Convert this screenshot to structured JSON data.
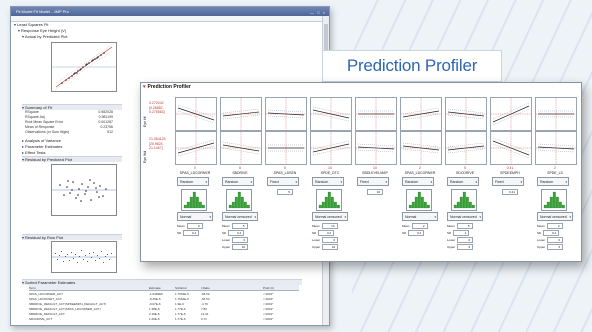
{
  "banner": {
    "title": "Prediction Profiler"
  },
  "back_window": {
    "title": "Fit Model Fit Model - JMP Pro",
    "controls": "— □ ×",
    "outline": {
      "root": "Least Squares Fit",
      "response": "Response Eye Height (V)",
      "actual_by_predicted": "Actual by Predicted Plot",
      "summary_of_fit": "Summary of Fit",
      "analysis_of_variance": "Analysis of Variance",
      "parameter_estimates": "Parameter Estimates",
      "effect_tests": "Effect Tests",
      "residual_by_predicted": "Residual by Predicted Plot",
      "residual_by_row": "Residual by Row Plot",
      "sorted_parameter_estimates": "Sorted Parameter Estimates"
    },
    "summary_rows": [
      {
        "label": "RSquare",
        "value": "0.982028"
      },
      {
        "label": "RSquare Adj",
        "value": "0.981199"
      },
      {
        "label": "Root Mean Square Error",
        "value": "0.001287"
      },
      {
        "label": "Mean of Response",
        "value": "0.23756"
      },
      {
        "label": "Observations (or Sum Wgts)",
        "value": "512"
      }
    ],
    "param_table": {
      "headers": [
        "Term",
        "Estimate",
        "Std Error",
        "t Ratio",
        "",
        "Prob>|t|"
      ],
      "rows": [
        [
          "SPAS_LDCORNER_ACT",
          "-1.0384E5",
          "1.7664E-5",
          "-65.69",
          "",
          "<.0001*"
        ],
        [
          "SPAS_LDOFFSET_ACT",
          "-9.45E-5",
          "1.7664E-5",
          "-53.53",
          "",
          "<.0001*"
        ],
        [
          "SBDRIVE_DEFAULT_ACT(SPDEEMPH_DEFAULT_ACT)",
          "-9.07E-6",
          "1.9E-6",
          "-4.76",
          "",
          "<.0001*"
        ],
        [
          "SBDRIVE_DEFAULT_ACT(SPAS_LDCORNER_ACT)",
          "1.38E-5",
          "1.77E-6",
          "7.80",
          "",
          "<.0001*"
        ],
        [
          "SBDRIVE_DEFAULT_ACT",
          "2.18E-5",
          "1.77E-6",
          "12.31",
          "",
          "<.0001*"
        ],
        [
          "SDCDRIVE_ACT",
          "1.26E-6",
          "1.77E-6",
          "0.71",
          "",
          "<.0001*"
        ]
      ]
    }
  },
  "profiler": {
    "title": "Prediction Profiler",
    "y_title_top": "Eye Ht",
    "y_values_top": [
      "0.272042",
      "[0.26852,",
      "0.275563]"
    ],
    "y_title_bottom": "Eye Wd",
    "y_values_bottom": [
      "21.054125",
      "[20.9624,",
      "21.1457]"
    ],
    "factors": [
      {
        "name": "SPAS_LDCORNER",
        "value": "0",
        "ctrl": "Random",
        "dist": "Normal",
        "f1": "Mean",
        "v1": "0",
        "f2": "SD",
        "v2": "0.4"
      },
      {
        "name": "SBDRIVE",
        "value": "5",
        "ctrl": "Random",
        "dist": "Normal censored",
        "f1": "Mean",
        "v1": "5",
        "f2": "SD",
        "v2": "0.4",
        "f3": "Lower",
        "v3": "0",
        "f4": "Upper",
        "v4": "10"
      },
      {
        "name": "SPAS_LDSEN",
        "value": "5",
        "ctrl": "Fixed",
        "dist": "",
        "f1": "",
        "v1": "5"
      },
      {
        "name": "SPDE_DTC",
        "value": "10",
        "ctrl": "Random",
        "dist": "Normal censored",
        "f1": "Mean",
        "v1": "10",
        "f2": "SD",
        "v2": "3.2",
        "f3": "Lower",
        "v3": "0",
        "f4": "Upper",
        "v4": "16"
      },
      {
        "name": "SBDLEVELMAP",
        "value": "10",
        "ctrl": "Fixed",
        "dist": "",
        "f1": "",
        "v1": "10"
      },
      {
        "name": "SPAS_LDCORNER",
        "value": "2",
        "ctrl": "Random",
        "dist": "Normal",
        "f1": "Mean",
        "v1": "2",
        "f2": "SD",
        "v2": "0.4"
      },
      {
        "name": "SDCDRIVE",
        "value": "5",
        "ctrl": "Random",
        "dist": "Normal censored",
        "f1": "Mean",
        "v1": "5",
        "f2": "SD",
        "v2": "1",
        "f3": "Lower",
        "v3": "0",
        "f4": "Upper",
        "v4": "9"
      },
      {
        "name": "SPDEEMPH",
        "value": "0.41",
        "ctrl": "Fixed",
        "dist": "",
        "f1": "",
        "v1": "0.41"
      },
      {
        "name": "SPDE_LS",
        "value": "2",
        "ctrl": "Random",
        "dist": "Normal censored",
        "f1": "Mean",
        "v1": "2",
        "f2": "SD",
        "v2": "0.4",
        "f3": "Lower",
        "v3": "0",
        "f4": "Upper",
        "v4": "5"
      }
    ]
  }
}
